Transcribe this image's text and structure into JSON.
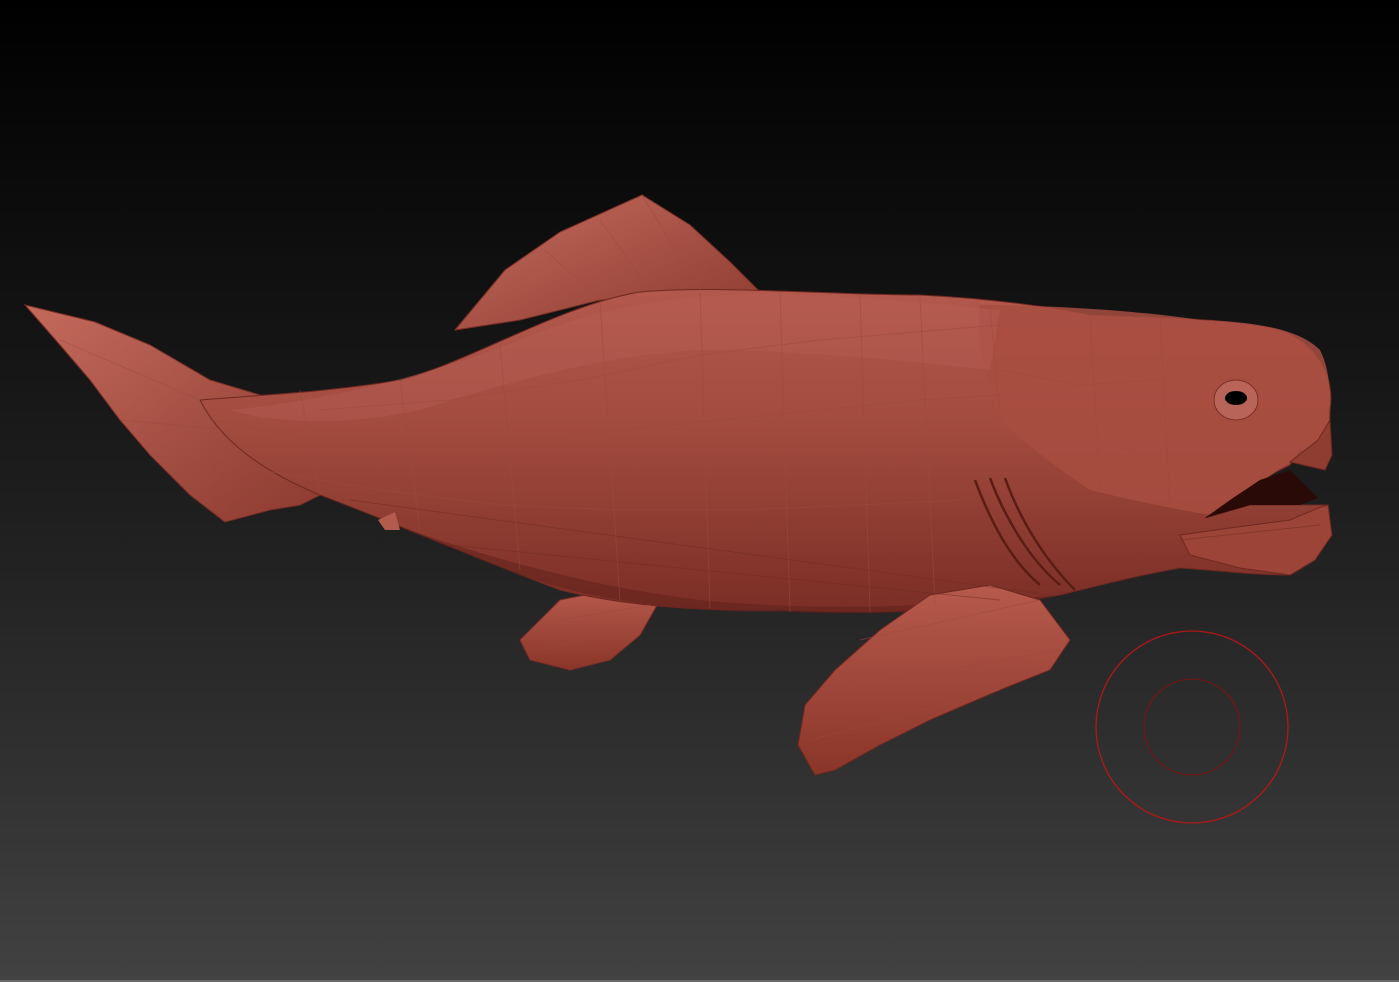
{
  "app": {
    "viewport": "3d-viewport",
    "model": "low-poly-fish-sculpt"
  },
  "colors": {
    "background_top": "#000000",
    "background_bottom": "#424242",
    "model_base": "#9c4336",
    "model_light": "#c2665a",
    "model_shadow": "#6a261e",
    "brush_cursor": "#b01818"
  },
  "icons": {
    "brush_cursor": "brush-cursor-icon"
  }
}
